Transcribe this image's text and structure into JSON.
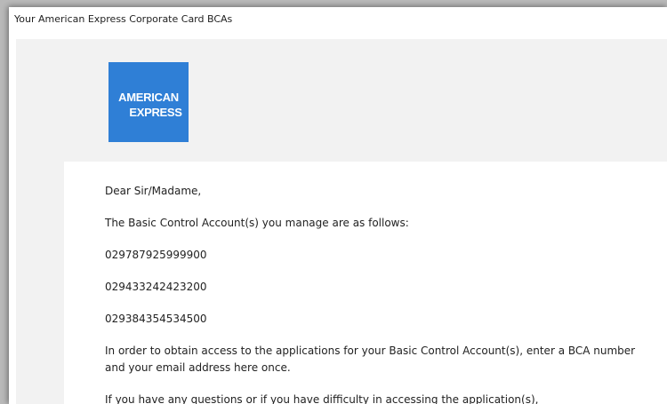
{
  "email": {
    "subject": "Your American Express Corporate Card BCAs",
    "logo": {
      "line1": "AMERICAN",
      "line2": "EXPRESS",
      "brand_color": "#2f7fd6"
    },
    "greeting": "Dear Sir/Madame,",
    "intro": "The Basic Control Account(s) you manage are as follows:",
    "accounts": [
      "029787925999900",
      "029433242423200",
      "029384354534500"
    ],
    "access_text": "In order to obtain access to the applications for your Basic Control Account(s), enter a BCA number and your email address here once.",
    "questions_text": "If you have any questions or if you have difficulty in accessing the application(s),"
  }
}
